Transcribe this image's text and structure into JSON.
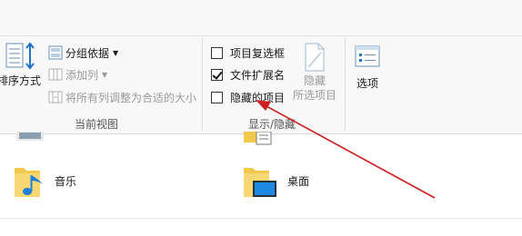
{
  "ribbon": {
    "current_view": {
      "group_label": "当前视图",
      "sort_label": "排序方式",
      "group_by_label": "分组依据",
      "add_column_label": "添加列",
      "fit_columns_label": "将所有列调整为合适的大小"
    },
    "show_hide": {
      "group_label": "显示/隐藏",
      "item_checkboxes_label": "项目复选框",
      "item_checkboxes_checked": false,
      "file_extensions_label": "文件扩展名",
      "file_extensions_checked": true,
      "hidden_items_label": "隐藏的项目",
      "hidden_items_checked": false,
      "hide_selected_line1": "隐藏",
      "hide_selected_line2": "所选项目"
    },
    "options_label": "选项"
  },
  "files": [
    {
      "name": "音乐",
      "icon": "music-folder-icon"
    },
    {
      "name": "桌面",
      "icon": "desktop-folder-icon"
    }
  ],
  "annotation": {
    "arrow_color": "#cc1f1f"
  },
  "colors": {
    "folder": "#f2c94c",
    "music_note": "#1e7fd6",
    "desktop_screen": "#1e88e5"
  }
}
